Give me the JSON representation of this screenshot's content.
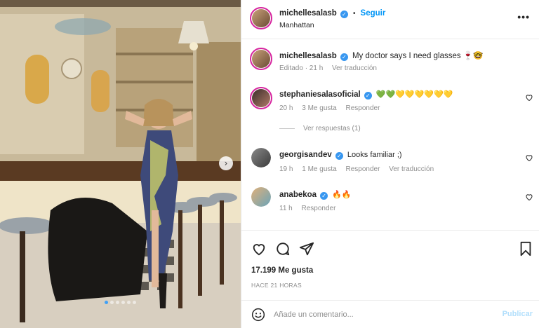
{
  "post": {
    "author": "michellesalasb",
    "follow_label": "Seguir",
    "dot_sep": "•",
    "location": "Manhattan",
    "more_icon": "more-horizontal-icon",
    "caption": "My doctor says I need glasses 🍷🤓",
    "caption_meta": {
      "edited": "Editado · 21 h",
      "translate": "Ver traducción"
    }
  },
  "comments": [
    {
      "user": "stephaniesalasoficial",
      "text": "💚💚💛💛💛💛💛💛",
      "time": "20 h",
      "likes": "3 Me gusta",
      "reply": "Responder",
      "view_replies": "Ver respuestas (1)"
    },
    {
      "user": "georgisandev",
      "text": "Looks familiar ;)",
      "time": "19 h",
      "likes": "1 Me gusta",
      "reply": "Responder",
      "translate": "Ver traducción"
    },
    {
      "user": "anabekoa",
      "text": "🔥🔥",
      "time": "11 h",
      "reply": "Responder"
    }
  ],
  "stats": {
    "likes": "17.199 Me gusta",
    "ago": "HACE 21 HORAS"
  },
  "composer": {
    "placeholder": "Añade un comentario...",
    "publish": "Publicar"
  },
  "carousel": {
    "slides": 6,
    "active": 0,
    "next_glyph": "›"
  },
  "colors": {
    "accent": "#0095f6",
    "verified": "#3897f0",
    "publish_disabled": "#b2dffc",
    "dot_active": "#3fa0f6"
  }
}
